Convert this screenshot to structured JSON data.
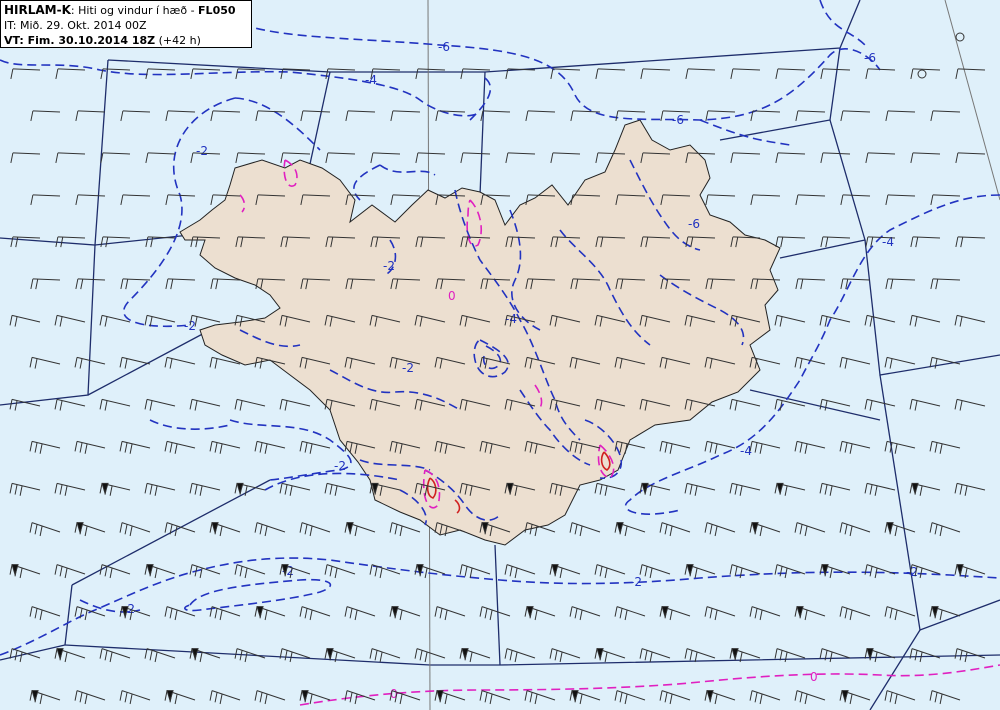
{
  "legend": {
    "product": "HIRLAM-K",
    "description": ": Hiti og vindur í hæð - ",
    "level": "FL050",
    "it_line": "IT: Mið. 29. Okt. 2014 00Z",
    "vt_label": "VT: Fim. 30.10.2014 18Z",
    "vt_lead": "(+42 h)"
  },
  "contour_labels": {
    "minus6_a": "-6",
    "minus6_b": "-6",
    "minus6_c": "-6",
    "minus6_d": "-6",
    "minus4_a": "-4",
    "minus4_b": "-4",
    "minus4_c": "-4",
    "minus4_d": "-4",
    "minus2_a": "-2",
    "minus2_b": "-2",
    "minus2_c": "-2",
    "minus2_d": "-2",
    "minus2_e": "-2",
    "minus2_f": "-2",
    "minus2_g": "-2",
    "minus2_h": "-2",
    "minus2_i": "-2",
    "zero_a": "0",
    "zero_b": "0",
    "zero_c": "0"
  },
  "colors": {
    "sea": "#dff0fa",
    "land": "#ecdfd0",
    "boundary": "#1e2d6b",
    "cold_contour": "#2233c0",
    "zero_contour": "#e020c0",
    "warm_contour": "#d02020",
    "wind_barb": "#333333"
  }
}
